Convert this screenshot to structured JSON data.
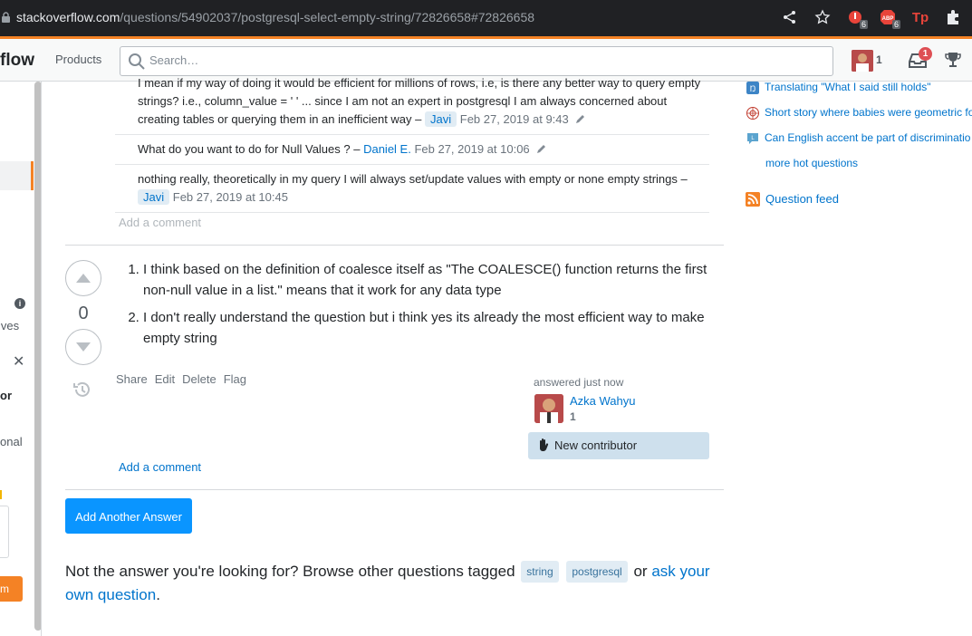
{
  "browser": {
    "url_host": "stackoverflow.com",
    "url_path": "/questions/54902037/postgresql-select-empty-string/72826658#72826658",
    "ext1_badge": "6",
    "ext2_badge": "6",
    "ext2_label": "ABP",
    "ext3_label": "Tp"
  },
  "topbar": {
    "logo": "flow",
    "products": "Products",
    "search_placeholder": "Search…",
    "reputation": "1",
    "inbox_count": "1"
  },
  "left_sidebar": {
    "text_ives": "ives",
    "text_or": "or",
    "text_onal": "onal",
    "text_m": "m"
  },
  "comments": [
    {
      "text": "I mean if my way of doing it would be efficient for millions of rows, i.e, is there any better way to query empty strings? i.e., column_value = ' ' ... since I am not an expert in postgresql I am always concerned about creating tables or querying them in an inefficient way –",
      "user": "Javi",
      "date": "Feb 27, 2019 at 9:43"
    },
    {
      "text": "What do you want to do for Null Values ? –",
      "user": "Daniel E.",
      "date": "Feb 27, 2019 at 10:06"
    },
    {
      "text": "nothing really, theoretically in my query I will always set/update values with empty or none empty strings –",
      "user": "Javi",
      "date": "Feb 27, 2019 at 10:45"
    }
  ],
  "add_comment_1": "Add a comment",
  "answer": {
    "votes": "0",
    "items": [
      "I think based on the definition of coalesce itself as \"The COALESCE() function returns the first non-null value in a list.\" means that it work for any data type",
      "I don't really understand the question but i think yes its already the most efficient way to make empty string"
    ],
    "menu": [
      "Share",
      "Edit",
      "Delete",
      "Flag"
    ],
    "answered": "answered just now",
    "user_name": "Azka Wahyu",
    "user_rep": "1",
    "new_contributor": "New contributor"
  },
  "add_comment_2": "Add a comment",
  "add_answer_button": "Add Another Answer",
  "not_answer": {
    "prefix": "Not the answer you're looking for? Browse other questions tagged",
    "tags": [
      "string",
      "postgresql"
    ],
    "or": "or",
    "ask_link": "ask your own question",
    "period": "."
  },
  "hot_network": [
    "Translating \"What I said still holds\"",
    "Short story where babies were geometric fo",
    "Can English accent be part of discriminatio"
  ],
  "more_hot": "more hot questions",
  "question_feed": "Question feed",
  "colors": {
    "accent_orange": "#f48225",
    "link_blue": "#0074cc",
    "button_blue": "#0a95ff",
    "tag_bg": "#e1ecf4"
  }
}
